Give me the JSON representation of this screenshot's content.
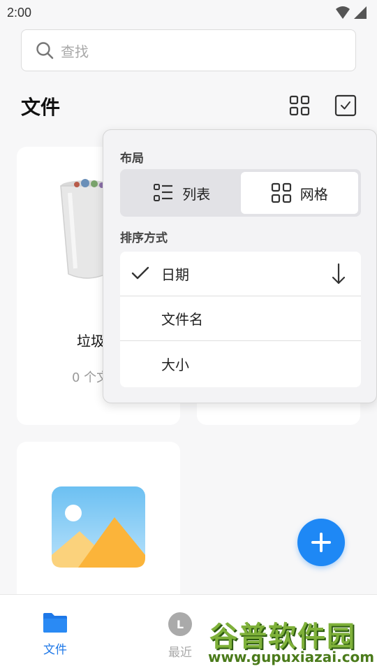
{
  "status_bar": {
    "time": "2:00"
  },
  "search": {
    "placeholder": "查找"
  },
  "header": {
    "title": "文件"
  },
  "cards": {
    "trash": {
      "title": "垃圾",
      "subtitle": "0 个文"
    }
  },
  "menu": {
    "layout_label": "布局",
    "layout_options": [
      {
        "label": "列表",
        "icon": "list-icon",
        "selected": false
      },
      {
        "label": "网格",
        "icon": "grid-icon",
        "selected": true
      }
    ],
    "sort_label": "排序方式",
    "sort_options": [
      {
        "label": "日期",
        "checked": true,
        "direction": "descending"
      },
      {
        "label": "文件名",
        "checked": false
      },
      {
        "label": "大小",
        "checked": false
      }
    ]
  },
  "bottom_nav": {
    "items": [
      {
        "label": "文件",
        "icon": "folder-icon",
        "active": true
      },
      {
        "label": "最近",
        "icon": "recent-icon",
        "badge": "L",
        "active": false
      }
    ]
  },
  "watermark": {
    "title": "谷普软件园",
    "url": "www.gupuxiazai.com"
  },
  "colors": {
    "accent": "#1e88f5",
    "nav_active": "#1e78e8"
  }
}
